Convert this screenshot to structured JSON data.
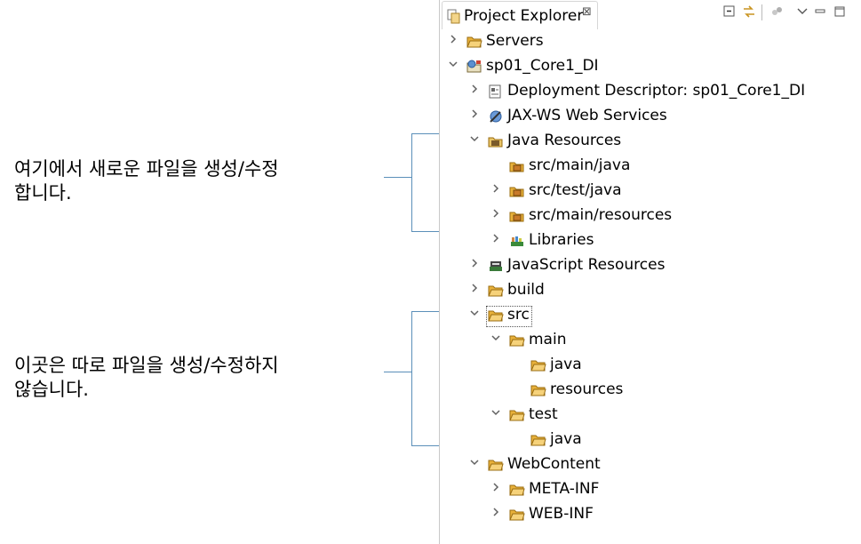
{
  "annotations": {
    "note1": "여기에서 새로운 파일을 생성/수정\n합니다.",
    "note2": "이곳은 따로 파일을 생성/수정하지\n않습니다."
  },
  "panel": {
    "tab_title": "Project Explorer",
    "tab_close": "⊠",
    "colors": {
      "folder": "#e8b13a",
      "bracket": "#5b8fb9",
      "border": "#c8c8c8"
    }
  },
  "tree": [
    {
      "label": "Servers",
      "expanded": false,
      "icon": "folder-icon"
    },
    {
      "label": "sp01_Core1_DI",
      "expanded": true,
      "icon": "web-project-icon"
    },
    {
      "label": "Deployment Descriptor: sp01_Core1_DI",
      "expanded": false,
      "icon": "descriptor-icon"
    },
    {
      "label": "JAX-WS Web Services",
      "expanded": false,
      "icon": "webservices-icon"
    },
    {
      "label": "Java Resources",
      "expanded": true,
      "icon": "java-resources-icon"
    },
    {
      "label": "src/main/java",
      "expanded": null,
      "icon": "package-folder-icon"
    },
    {
      "label": "src/test/java",
      "expanded": false,
      "icon": "package-folder-icon"
    },
    {
      "label": "src/main/resources",
      "expanded": false,
      "icon": "package-folder-icon"
    },
    {
      "label": "Libraries",
      "expanded": false,
      "icon": "libraries-icon"
    },
    {
      "label": "JavaScript Resources",
      "expanded": false,
      "icon": "js-resources-icon"
    },
    {
      "label": "build",
      "expanded": false,
      "icon": "folder-icon"
    },
    {
      "label": "src",
      "expanded": true,
      "icon": "folder-icon"
    },
    {
      "label": "main",
      "expanded": true,
      "icon": "folder-icon"
    },
    {
      "label": "java",
      "expanded": null,
      "icon": "folder-icon"
    },
    {
      "label": "resources",
      "expanded": null,
      "icon": "folder-icon"
    },
    {
      "label": "test",
      "expanded": true,
      "icon": "folder-icon"
    },
    {
      "label": "java",
      "expanded": null,
      "icon": "folder-icon"
    },
    {
      "label": "WebContent",
      "expanded": true,
      "icon": "folder-icon"
    },
    {
      "label": "META-INF",
      "expanded": false,
      "icon": "folder-icon"
    },
    {
      "label": "WEB-INF",
      "expanded": false,
      "icon": "folder-icon"
    }
  ]
}
